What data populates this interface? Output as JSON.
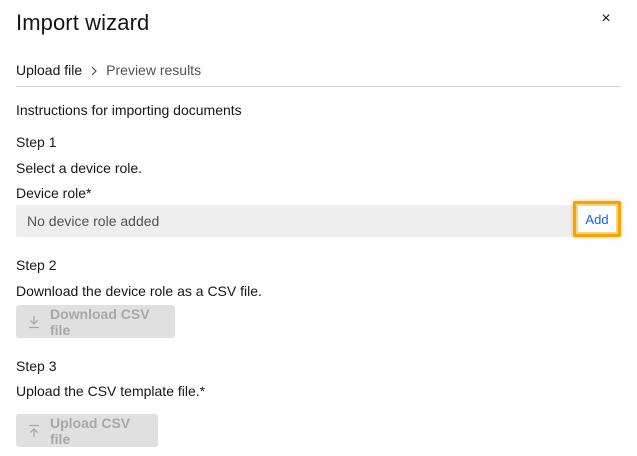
{
  "header": {
    "title": "Import wizard",
    "close_label": "×"
  },
  "breadcrumb": {
    "current": "Upload file",
    "next": "Preview results"
  },
  "instructions": "Instructions for importing documents",
  "step1": {
    "heading": "Step 1",
    "text": "Select a device role.",
    "field_label": "Device role*",
    "field_value": "No device role added",
    "add_label": "Add"
  },
  "step2": {
    "heading": "Step 2",
    "text": "Download the device role as a CSV file.",
    "button_label": "Download CSV file",
    "button_icon": "download-icon"
  },
  "step3": {
    "heading": "Step 3",
    "text": "Upload the CSV template file.*",
    "button_label": "Upload CSV file",
    "button_icon": "upload-icon"
  },
  "colors": {
    "accent_link": "#0f62fe",
    "highlight": "#f5a300",
    "field_bg": "#eeeeef",
    "disabled_bg": "#e0e0e0",
    "disabled_text": "#a8a8a8"
  }
}
